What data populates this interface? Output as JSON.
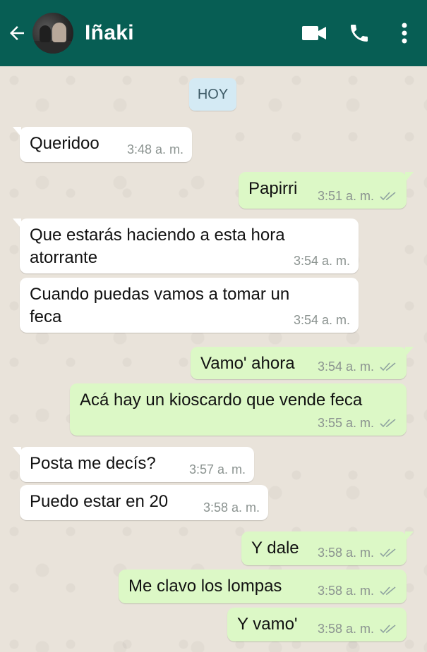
{
  "header": {
    "contact_name": "Iñaki",
    "background_color": "#075e54",
    "icons": [
      "back-arrow-icon",
      "video-call-icon",
      "phone-icon",
      "more-vert-icon"
    ]
  },
  "date_chip": "HOY",
  "messages": [
    {
      "dir": "in",
      "text": "Queridoo",
      "time": "3:48 a. m."
    },
    {
      "dir": "out",
      "text": "Papirri",
      "time": "3:51 a. m.",
      "status": "read"
    },
    {
      "dir": "in",
      "text": "Que estarás haciendo a esta hora\natorrante",
      "time": "3:54 a. m."
    },
    {
      "dir": "in",
      "text": "Cuando puedas vamos a tomar un\nfeca",
      "time": "3:54 a. m."
    },
    {
      "dir": "out",
      "text": "Vamo' ahora",
      "time": "3:54 a. m.",
      "status": "read"
    },
    {
      "dir": "out",
      "text": "Acá hay un kioscardo que vende feca",
      "time": "3:55 a. m.",
      "status": "read"
    },
    {
      "dir": "in",
      "text": "Posta me decís?",
      "time": "3:57 a. m."
    },
    {
      "dir": "in",
      "text": "Puedo estar en 20",
      "time": "3:58 a. m."
    },
    {
      "dir": "out",
      "text": "Y dale",
      "time": "3:58 a. m.",
      "status": "read"
    },
    {
      "dir": "out",
      "text": "Me clavo los lompas",
      "time": "3:58 a. m.",
      "status": "read"
    },
    {
      "dir": "out",
      "text": "Y vamo'",
      "time": "3:58 a. m.",
      "status": "read"
    }
  ],
  "colors": {
    "incoming": "#ffffff",
    "outgoing": "#dcf8c6",
    "chat_background": "#e9e3da"
  }
}
